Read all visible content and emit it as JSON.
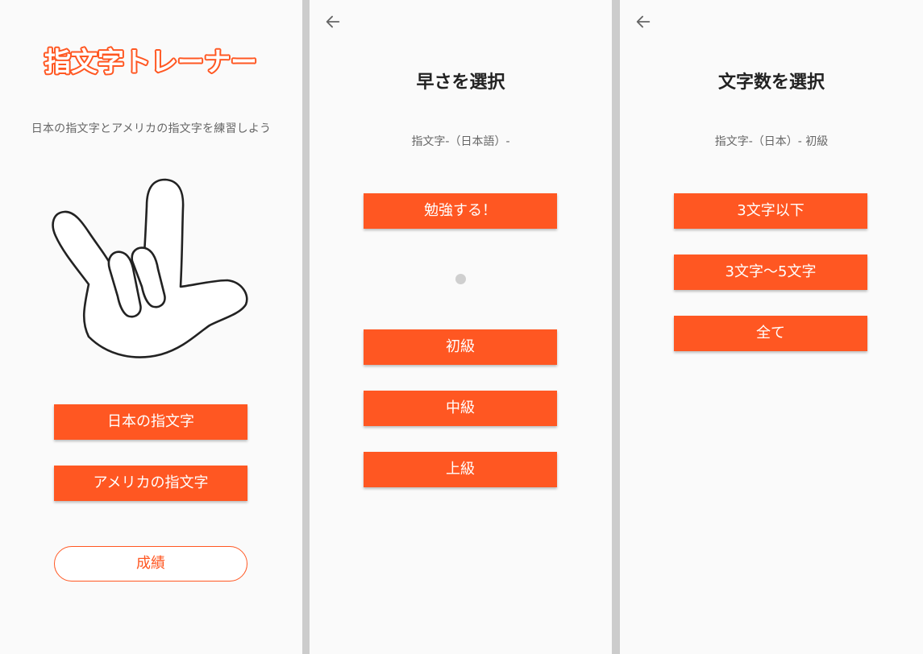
{
  "colors": {
    "accent": "#ff5722",
    "background": "#fafafa",
    "divider": "#cccccc"
  },
  "home": {
    "logo_text": "指文字トレーナー",
    "subtitle": "日本の指文字とアメリカの指文字を練習しよう",
    "japanese_button": "日本の指文字",
    "american_button": "アメリカの指文字",
    "results_button": "成績"
  },
  "speed": {
    "back_icon": "arrow-left-icon",
    "title": "早さを選択",
    "subtitle": "指文字-（日本語）-",
    "study_button": "勉強する！",
    "beginner_button": "初級",
    "intermediate_button": "中級",
    "advanced_button": "上級"
  },
  "length": {
    "back_icon": "arrow-left-icon",
    "title": "文字数を選択",
    "subtitle": "指文字-（日本）- 初級",
    "under3_button": "3文字以下",
    "range_button": "3文字〜5文字",
    "all_button": "全て"
  }
}
